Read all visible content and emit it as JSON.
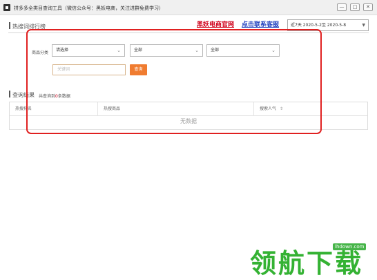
{
  "window": {
    "title": "拼多多全类目查询工具（微信公众号：黑妖电商，关注进群免费学习）",
    "controls": {
      "minimize": "—",
      "maximize": "□",
      "close": "✕"
    }
  },
  "header": {
    "section_title": "热搜词排行榜",
    "link_official": "黑妖电商官网",
    "link_service": "点击联系客服",
    "date_range": "近7天 2020-5-2至 2020-5-8"
  },
  "filters": {
    "category_label": "商品分类",
    "select1": "请选择",
    "select2": "全部",
    "select3": "全部",
    "keyword_placeholder": "关键词",
    "query_button": "查询"
  },
  "results": {
    "section_title": "查询结果",
    "note_prefix": "共查询到",
    "note_count": "0",
    "note_suffix": "条数据",
    "columns": [
      "热搜排名",
      "热搜商品",
      "搜索人气"
    ],
    "empty_text": "无数据"
  },
  "watermark": {
    "text": "领航下载",
    "url": "lhdown.com"
  },
  "icons": [
    "app-icon",
    "sort-icon",
    "chevron-down-icon"
  ],
  "colors": {
    "accent_red": "#d0021b",
    "link_blue": "#1e3fbf",
    "button_orange": "#f07c30",
    "highlight_red": "#e02020",
    "watermark_green": "#34b233"
  }
}
